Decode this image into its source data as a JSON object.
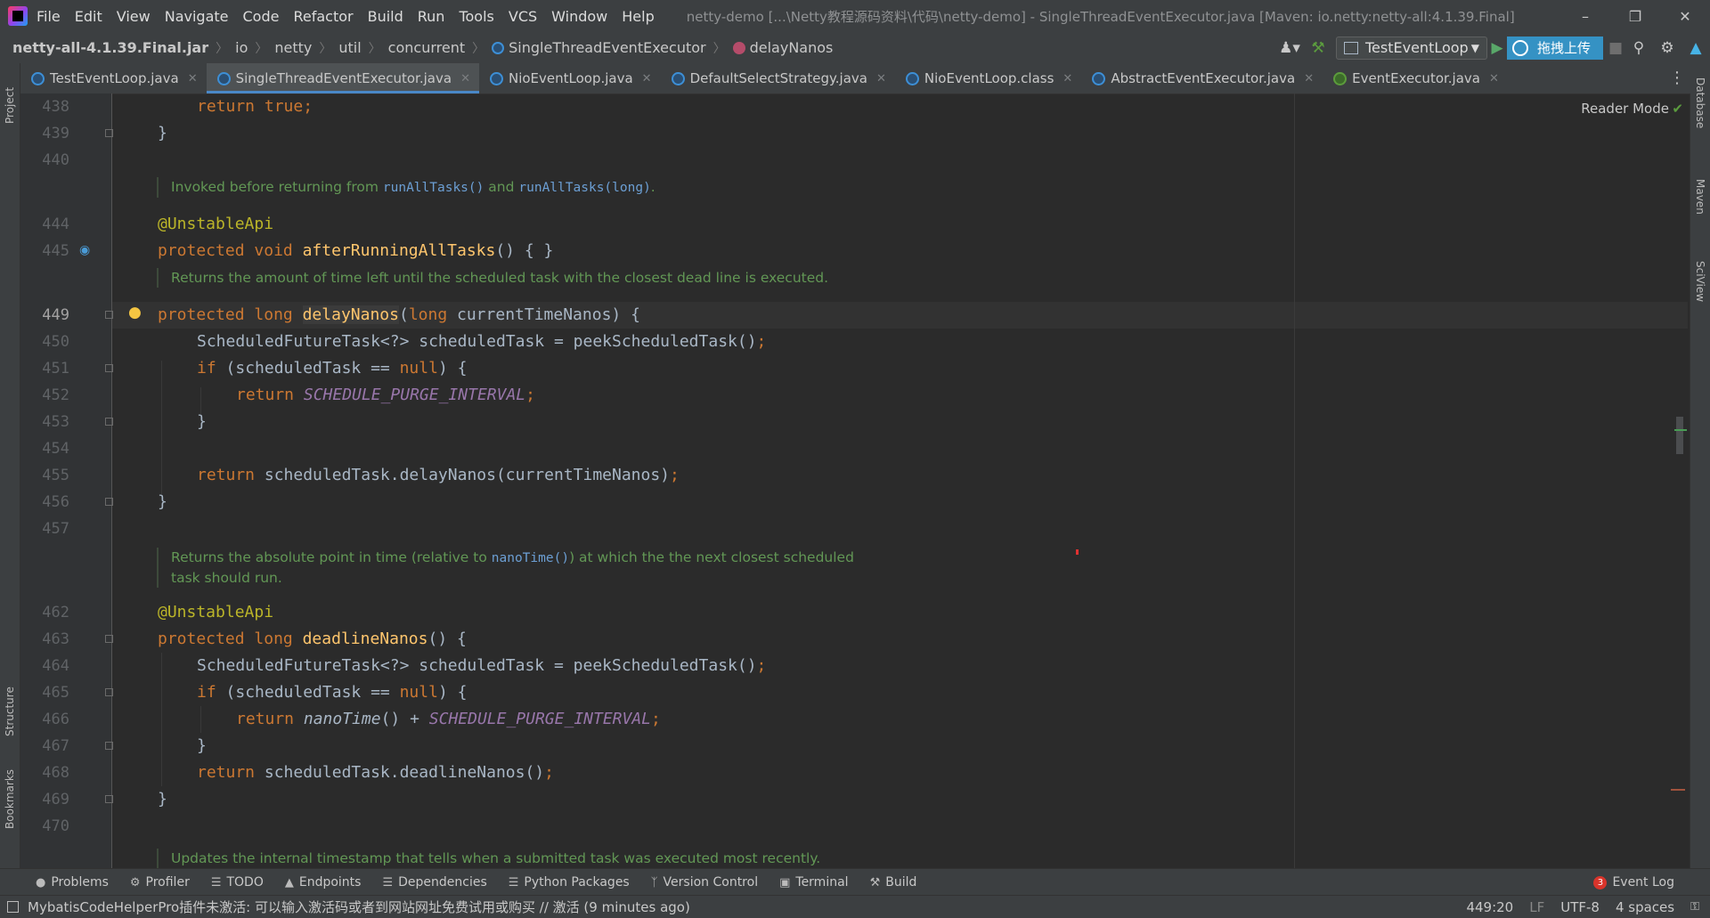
{
  "menubar": {
    "items": [
      "File",
      "Edit",
      "View",
      "Navigate",
      "Code",
      "Refactor",
      "Build",
      "Run",
      "Tools",
      "VCS",
      "Window",
      "Help"
    ],
    "title": "netty-demo [...\\Netty教程源码资料\\代码\\netty-demo] - SingleThreadEventExecutor.java [Maven: io.netty:netty-all:4.1.39.Final]"
  },
  "breadcrumb": {
    "jar": "netty-all-4.1.39.Final.jar",
    "items": [
      "io",
      "netty",
      "util",
      "concurrent"
    ],
    "class": "SingleThreadEventExecutor",
    "method": "delayNanos"
  },
  "toolbar": {
    "run_config": "TestEventLoop",
    "upload_label": "拖拽上传"
  },
  "tabs": [
    {
      "label": "TestEventLoop.java",
      "active": false,
      "type": "class"
    },
    {
      "label": "SingleThreadEventExecutor.java",
      "active": true,
      "type": "class"
    },
    {
      "label": "NioEventLoop.java",
      "active": false,
      "type": "class"
    },
    {
      "label": "DefaultSelectStrategy.java",
      "active": false,
      "type": "class"
    },
    {
      "label": "NioEventLoop.class",
      "active": false,
      "type": "class"
    },
    {
      "label": "AbstractEventExecutor.java",
      "active": false,
      "type": "class"
    },
    {
      "label": "EventExecutor.java",
      "active": false,
      "type": "interface"
    }
  ],
  "side": {
    "left_top": "Project",
    "left_mid": "Structure",
    "left_bottom": "Bookmarks",
    "right": [
      "Database",
      "Maven",
      "SciView"
    ]
  },
  "editor": {
    "reader_mode": "Reader Mode",
    "line_numbers": [
      "438",
      "439",
      "440",
      "444",
      "445",
      "449",
      "450",
      "451",
      "452",
      "453",
      "454",
      "455",
      "456",
      "457",
      "462",
      "463",
      "464",
      "465",
      "466",
      "467",
      "468",
      "469",
      "470"
    ],
    "current_line": "449",
    "docs": {
      "d1_a": "Invoked before returning from ",
      "d1_code1": "runAllTasks()",
      "d1_b": " and ",
      "d1_code2": "runAllTasks(long)",
      "d1_c": ".",
      "d2": "Returns the amount of time left until the scheduled task with the closest dead line is executed.",
      "d3_a": "Returns the absolute point in time (relative to ",
      "d3_code": "nanoTime()",
      "d3_b": ") at which the the next closest scheduled",
      "d3_c": "task should run.",
      "d4": "Updates the internal timestamp that tells when a submitted task was executed most recently."
    },
    "code": {
      "return": "return",
      "true": "true",
      "semicolon": ";",
      "brace_close": "}",
      "annotation": "@UnstableApi",
      "protected": "protected",
      "void": "void",
      "long": "long",
      "if": "if",
      "null": "null",
      "afterRunningAllTasks": "afterRunningAllTasks",
      "empty_body": "() { }",
      "delayNanos": "delayNanos",
      "param": " currentTimeNanos) {",
      "paren_open": "(",
      "sft_decl": "ScheduledFutureTask<?> scheduledTask = peekScheduledTask()",
      "if_cond": " (scheduledTask == ",
      "if_close": ") {",
      "purge": "SCHEDULE_PURGE_INTERVAL",
      "return_delay": " scheduledTask.delayNanos(currentTimeNanos)",
      "deadlineNanos": "deadlineNanos",
      "deadline_sig": "() {",
      "nanoTime": "nanoTime",
      "nano_plus": "() + ",
      "return_deadline": " scheduledTask.deadlineNanos()"
    }
  },
  "bottom_tools": [
    "Problems",
    "Profiler",
    "TODO",
    "Endpoints",
    "Dependencies",
    "Python Packages",
    "Version Control",
    "Terminal",
    "Build"
  ],
  "event_log": {
    "label": "Event Log",
    "count": "3"
  },
  "status": {
    "message": "MybatisCodeHelperPro插件未激活: 可以输入激活码或者到网站网址免费试用或购买 // 激活 (9 minutes ago)",
    "position": "449:20",
    "line_sep": "LF",
    "encoding": "UTF-8",
    "indent": "4 spaces"
  },
  "colors": {
    "accent": "#4a88c7",
    "keyword": "#cc7832",
    "function": "#ffc66d",
    "annotation": "#bbb529",
    "constant": "#9876aa",
    "doc": "#629755"
  }
}
